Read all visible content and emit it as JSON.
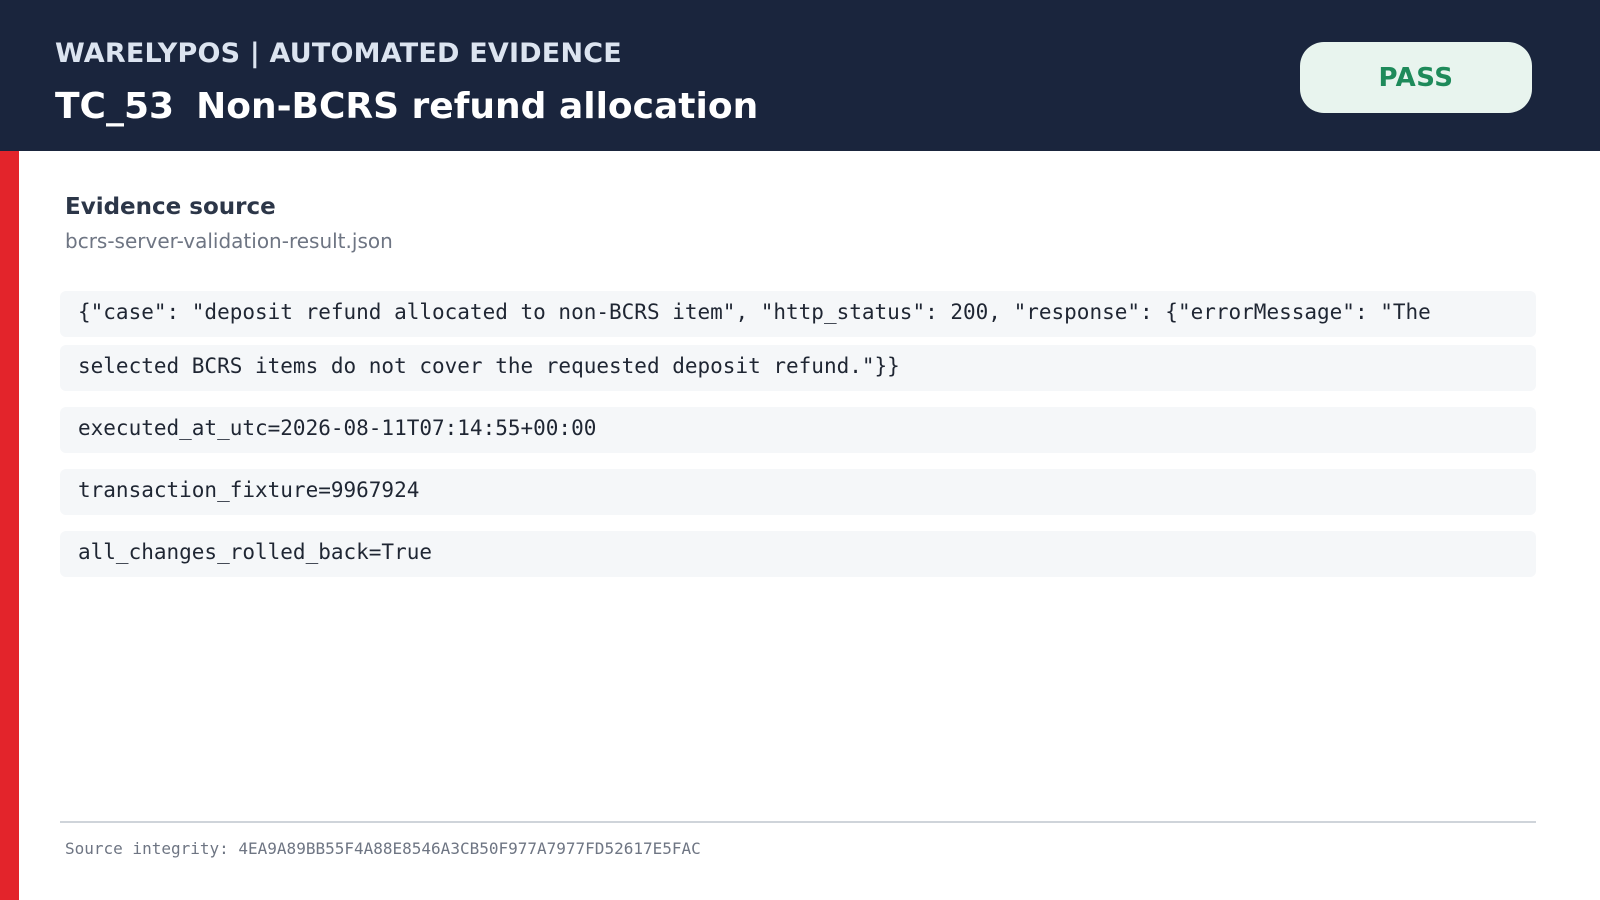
{
  "header": {
    "brand": "WARELYPOS  |  AUTOMATED EVIDENCE",
    "test_id": "TC_53",
    "test_name": "Non-BCRS refund allocation",
    "status": "PASS"
  },
  "evidence": {
    "heading": "Evidence source",
    "file": "bcrs-server-validation-result.json",
    "lines": [
      "{\"case\": \"deposit refund allocated to non-BCRS item\", \"http_status\": 200, \"response\": {\"errorMessage\": \"The",
      "selected BCRS items do not cover the requested deposit refund.\"}}",
      "executed_at_utc=2026-08-11T07:14:55+00:00",
      "transaction_fixture=9967924",
      "all_changes_rolled_back=True"
    ]
  },
  "footer": {
    "integrity": "Source integrity: 4EA9A89BB55F4A88E8546A3CB50F977A7977FD52617E5FAC"
  },
  "colors": {
    "header_bg": "#1a253d",
    "accent": "#e3242b",
    "pass_text": "#1e8a5a",
    "pass_bg": "#e8f4ee"
  }
}
